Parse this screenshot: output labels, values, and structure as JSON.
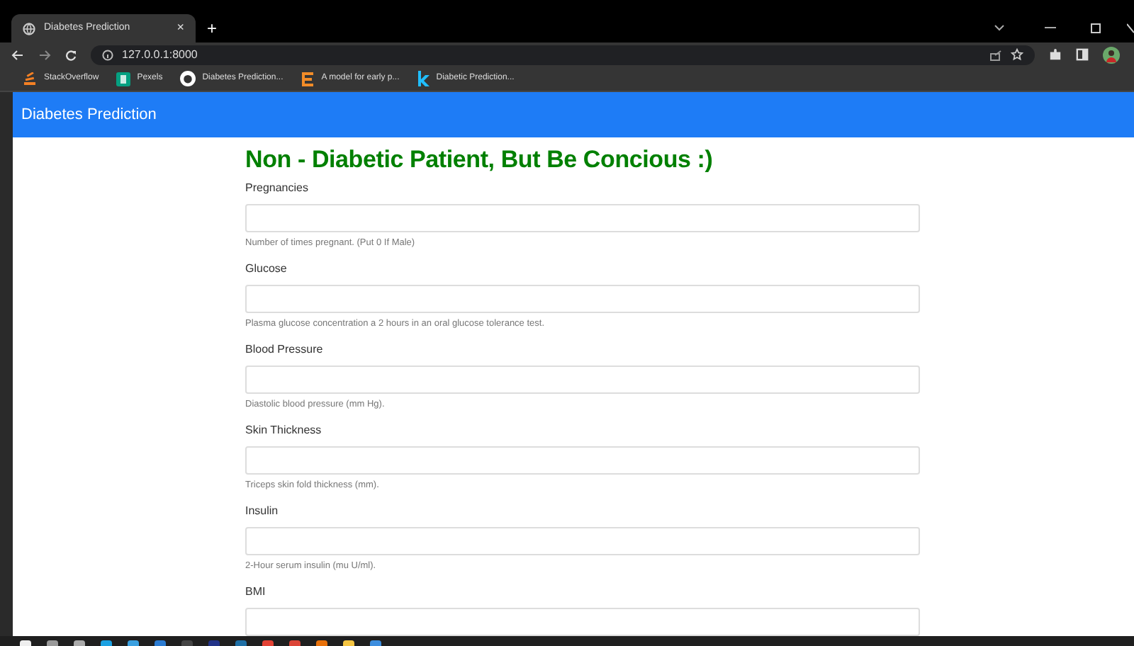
{
  "browser": {
    "tab_title": "Diabetes Prediction",
    "tab_close": "×",
    "new_tab": "+",
    "url": "127.0.0.1:8000",
    "bookmarks": [
      {
        "kind": "so",
        "label": "StackOverflow"
      },
      {
        "kind": "pexels",
        "label": "Pexels"
      },
      {
        "kind": "github",
        "label": "Diabetes Prediction..."
      },
      {
        "kind": "e",
        "label": "A model for early p..."
      },
      {
        "kind": "k",
        "label": "Diabetic Prediction..."
      }
    ]
  },
  "navbar": {
    "brand": "Diabetes Prediction"
  },
  "result": {
    "text": "Non - Diabetic Patient, But Be Concious :)",
    "color": "#008000"
  },
  "fields": [
    {
      "label": "Pregnancies",
      "help": "Number of times pregnant. (Put 0 If Male)"
    },
    {
      "label": "Glucose",
      "help": "Plasma glucose concentration a 2 hours in an oral glucose tolerance test."
    },
    {
      "label": "Blood Pressure",
      "help": "Diastolic blood pressure (mm Hg)."
    },
    {
      "label": "Skin Thickness",
      "help": "Triceps skin fold thickness (mm)."
    },
    {
      "label": "Insulin",
      "help": "2-Hour serum insulin (mu U/ml)."
    },
    {
      "label": "BMI"
    }
  ]
}
